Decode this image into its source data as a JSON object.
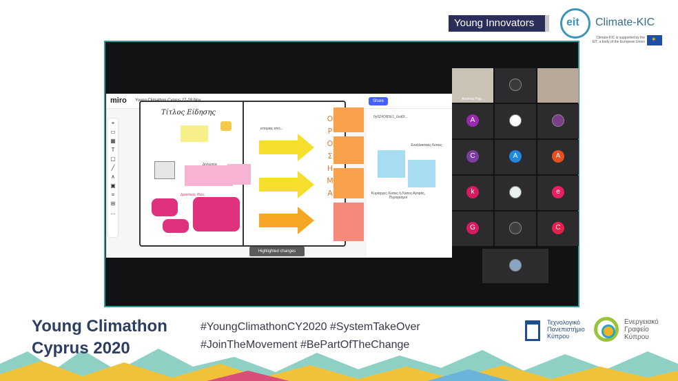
{
  "header": {
    "badge": "Young Innovators",
    "partner_logo_text": "eit",
    "partner_name": "Climate-KIC",
    "partner_sub": "Climate-KIC is supported by the EIT, a body of the European Union"
  },
  "miro": {
    "logo": "miro",
    "board_title": "Young Climathon Cyprus 27-28 Nov",
    "book_title": "Τίτλος Είδησης",
    "vertical_word": [
      "Ο",
      "Ρ",
      "Ο",
      "Σ",
      "Η",
      "Μ",
      "Α"
    ],
    "section_intro": "ιστορίας από...",
    "section_statement": "Δηλώσεις",
    "section_activities": "Δραστικές Ιδέες",
    "highlighted_changes": "Highlighted changes",
    "tools": [
      "⌖",
      "▭",
      "▦",
      "T",
      "▢",
      "╱",
      "∧",
      "▣",
      "⌗",
      "⊞",
      "…"
    ]
  },
  "board2": {
    "share_label": "Share",
    "board_id": "0y0Z4OR5E1_6ed0f...",
    "label_alternatives": "Εναλλακτικές Λύσεις",
    "label_bottom": "Κυρίαρχες Λύσεις ή Λύσεις Αγοράς, Περιορισμοί"
  },
  "participants": [
    {
      "type": "video",
      "name": "Andreas Pap...",
      "bg": "#c9c3b6"
    },
    {
      "type": "photo",
      "bg": "#3b3b3d"
    },
    {
      "type": "video",
      "name": "",
      "bg": "#b7a89a"
    },
    {
      "type": "avatar",
      "initial": "A",
      "color": "#9c27b0"
    },
    {
      "type": "photo",
      "bg": "#ffffff"
    },
    {
      "type": "photo",
      "bg": "#7b3f8a"
    },
    {
      "type": "avatar",
      "initial": "C",
      "color": "#7e3da3"
    },
    {
      "type": "avatar",
      "initial": "A",
      "color": "#1e88e5"
    },
    {
      "type": "avatar",
      "initial": "A",
      "color": "#e6501e"
    },
    {
      "type": "avatar",
      "initial": "k",
      "color": "#d81b60"
    },
    {
      "type": "photo",
      "bg": "#e8f0f0"
    },
    {
      "type": "avatar",
      "initial": "e",
      "color": "#e91e63"
    },
    {
      "type": "avatar",
      "initial": "G",
      "color": "#d81b60"
    },
    {
      "type": "photo",
      "bg": "#3f3f3f"
    },
    {
      "type": "avatar",
      "initial": "C",
      "color": "#e5204a"
    },
    {
      "type": "photo",
      "bg": "#8aa5c4"
    }
  ],
  "footer": {
    "title_line1": "Young Climathon",
    "title_line2": "Cyprus 2020",
    "hashtags_line1": "#YoungClimathonCY2020  #SystemTakeOver",
    "hashtags_line2": "#JoinTheMovement  #BePartOfTheChange",
    "tepak_line1": "Τεχνολογικό",
    "tepak_line2": "Πανεπιστήμιο",
    "tepak_line3": "Κύπρου",
    "eocy_line1": "Ενεργειακό",
    "eocy_line2": "Γραφείο",
    "eocy_line3": "Κύπρου"
  }
}
